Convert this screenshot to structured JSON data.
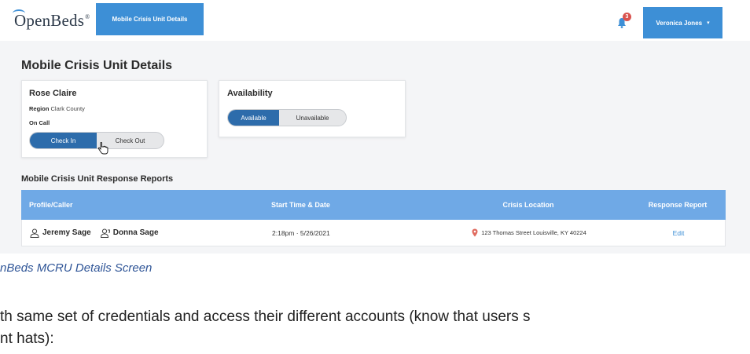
{
  "topbar": {
    "logo_text": "OpenBeds",
    "logo_mark": "®",
    "nav_tab_label": "Mobile Crisis Unit Details",
    "notification_count": "3",
    "user_name": "Veronica Jones",
    "user_caret": "▾"
  },
  "page": {
    "title": "Mobile Crisis Unit Details"
  },
  "person_card": {
    "name": "Rose Claire",
    "region_label": "Region",
    "region_value": "Clark County",
    "status": "On Call",
    "check_in_label": "Check In",
    "check_out_label": "Check Out"
  },
  "availability_card": {
    "title": "Availability",
    "available_label": "Available",
    "unavailable_label": "Unavailable"
  },
  "reports": {
    "title": "Mobile Crisis Unit Response Reports",
    "columns": [
      "Profile/Caller",
      "Start Time & Date",
      "Crisis Location",
      "Response Report"
    ],
    "rows": [
      {
        "profile": "Jeremy Sage",
        "caller": "Donna Sage",
        "start": "2:18pm · 5/26/2021",
        "location": "123 Thomas Street Louisville, KY 40224",
        "action": "Edit"
      }
    ]
  },
  "document": {
    "caption": "nBeds MCRU Details Screen",
    "line1": "th same set of credentials and access their different accounts (know that users s",
    "line2": "nt hats):"
  },
  "colors": {
    "primary": "#3d8fd6",
    "active_toggle": "#2d6cab",
    "table_header": "#6fa9e6",
    "badge": "#d9534f",
    "caption": "#2f5597"
  }
}
